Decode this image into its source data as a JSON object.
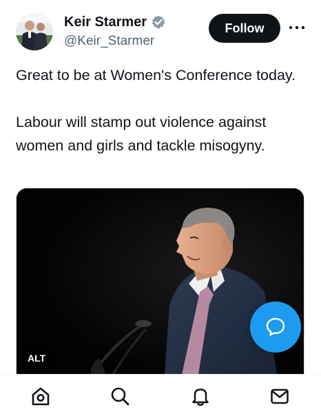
{
  "author": {
    "display_name": "Keir Starmer",
    "handle": "@Keir_Starmer",
    "verified": true,
    "avatar_icon": "profile-photo"
  },
  "actions": {
    "follow_label": "Follow",
    "more_icon": "more-horizontal-icon"
  },
  "tweet": {
    "paragraphs": [
      "Great to be at Women's Conference today.",
      "Labour will stamp out violence against women and girls and tackle misogyny."
    ]
  },
  "media": {
    "alt_label": "ALT"
  },
  "compose": {
    "icon": "compose-icon",
    "color": "#1d9bf0"
  },
  "nav": {
    "items": [
      {
        "icon": "home-icon"
      },
      {
        "icon": "search-icon"
      },
      {
        "icon": "notifications-bell-icon"
      },
      {
        "icon": "messages-envelope-icon"
      }
    ]
  },
  "colors": {
    "text": "#0f1419",
    "secondary": "#536471",
    "verified_badge": "#8c9aa6",
    "accent": "#1d9bf0"
  }
}
